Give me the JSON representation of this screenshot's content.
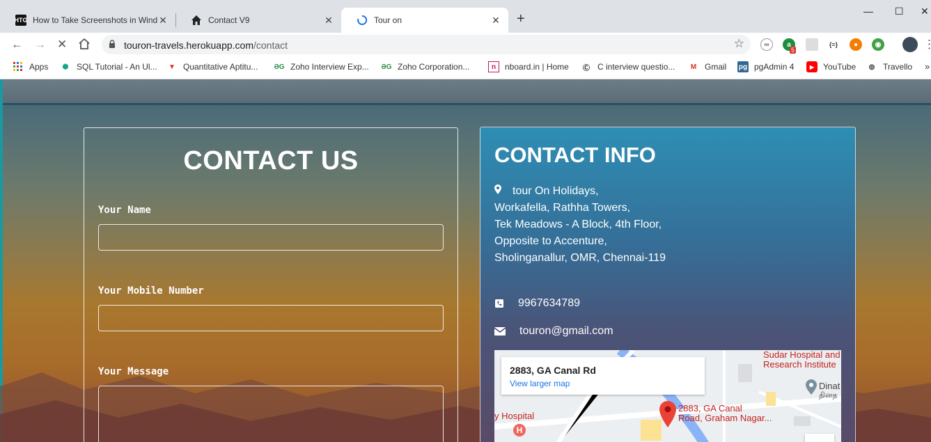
{
  "browser": {
    "tabs": [
      {
        "title": "How to Take Screenshots in Wind",
        "favicon": "htg-icon"
      },
      {
        "title": "Contact V9",
        "favicon": "home-icon"
      },
      {
        "title": "Tour on",
        "favicon": "loading-spinner-icon"
      }
    ],
    "url_host": "touron-travels.herokuapp.com",
    "url_path": "/contact",
    "extension_badge": "5",
    "bookmarks": [
      {
        "label": "Apps"
      },
      {
        "label": "SQL Tutorial - An Ul..."
      },
      {
        "label": "Quantitative Aptitu..."
      },
      {
        "label": "Zoho Interview Exp..."
      },
      {
        "label": "Zoho Corporation..."
      },
      {
        "label": "nboard.in | Home"
      },
      {
        "label": "C interview questio..."
      },
      {
        "label": "Gmail"
      },
      {
        "label": "pgAdmin 4"
      },
      {
        "label": "YouTube"
      },
      {
        "label": "Travello"
      }
    ]
  },
  "contact_form": {
    "title": "CONTACT US",
    "name_label": "Your Name",
    "mobile_label": "Your Mobile Number",
    "message_label": "Your Message",
    "name_value": "",
    "mobile_value": "",
    "message_value": ""
  },
  "contact_info": {
    "title": "CONTACT INFO",
    "address_lines": [
      "tour On Holidays,",
      "Workafella, Rathha Towers,",
      "Tek Meadows - A Block, 4th Floor,",
      "Opposite to Accenture,",
      "Sholinganallur, OMR, Chennai-119"
    ],
    "phone": "9967634789",
    "email": "touron@gmail.com"
  },
  "map": {
    "place_title": "2883, GA Canal Rd",
    "larger_map_link": "View larger map",
    "marker_label_1": "2883, GA Canal",
    "marker_label_2": "Road, Graham Nagar...",
    "poi_hospital_1": "Sudar Hospital and",
    "poi_hospital_2": "Research Institute",
    "poi_hospital_left": "y Hospital",
    "poi_dinat": "Dinat",
    "poi_tamil": "தினத"
  },
  "colors": {
    "info_panel_top": "#2e8eb4",
    "map_marker": "#ea4335",
    "link": "#1a73e8"
  }
}
